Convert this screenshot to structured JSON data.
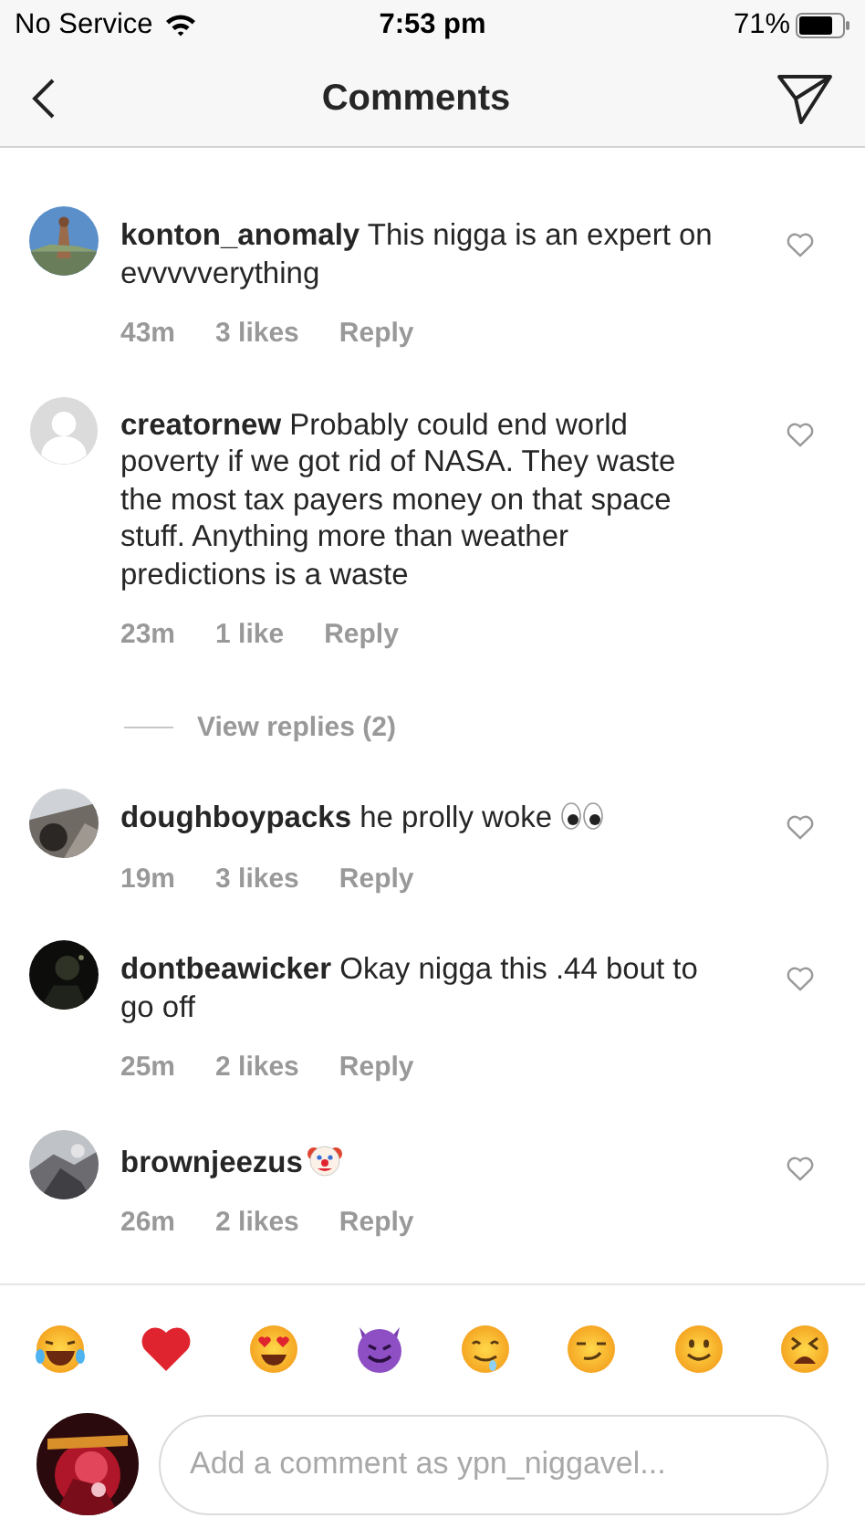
{
  "status_bar": {
    "carrier": "No Service",
    "time": "7:53 pm",
    "battery": "71%"
  },
  "header": {
    "title": "Comments"
  },
  "comments": [
    {
      "kind": "comment",
      "username": "konton_anomaly",
      "text": "This nigga is an expert on evvvvverything",
      "time": "43m",
      "likes": "3 likes",
      "reply": "Reply",
      "liked": false
    },
    {
      "kind": "comment",
      "avatar": {
        "kind": "placeholder"
      },
      "username": "creatornew",
      "text": "Probably could end world poverty if we got rid of NASA. They waste the most tax payers money on that space stuff. Anything more than weather predictions is a waste",
      "time": "23m",
      "likes": "1 like",
      "reply": "Reply",
      "liked": false
    },
    {
      "kind": "replies",
      "label": "View replies (2)"
    },
    {
      "kind": "comment",
      "username": "doughboypacks",
      "text": "he prolly woke",
      "emoji": {
        "kind": "eyes"
      },
      "time": "19m",
      "likes": "3 likes",
      "reply": "Reply",
      "liked": false
    },
    {
      "kind": "comment",
      "username": "dontbeawicker",
      "text": "Okay nigga this .44 bout to go off",
      "time": "25m",
      "likes": "2 likes",
      "reply": "Reply",
      "liked": false
    },
    {
      "kind": "comment",
      "username": "brownjeezus",
      "emoji": {
        "kind": "clown"
      },
      "time": "26m",
      "likes": "2 likes",
      "reply": "Reply",
      "liked": false
    }
  ],
  "composer": {
    "placeholder": "Add a comment as ypn_niggavel..."
  }
}
